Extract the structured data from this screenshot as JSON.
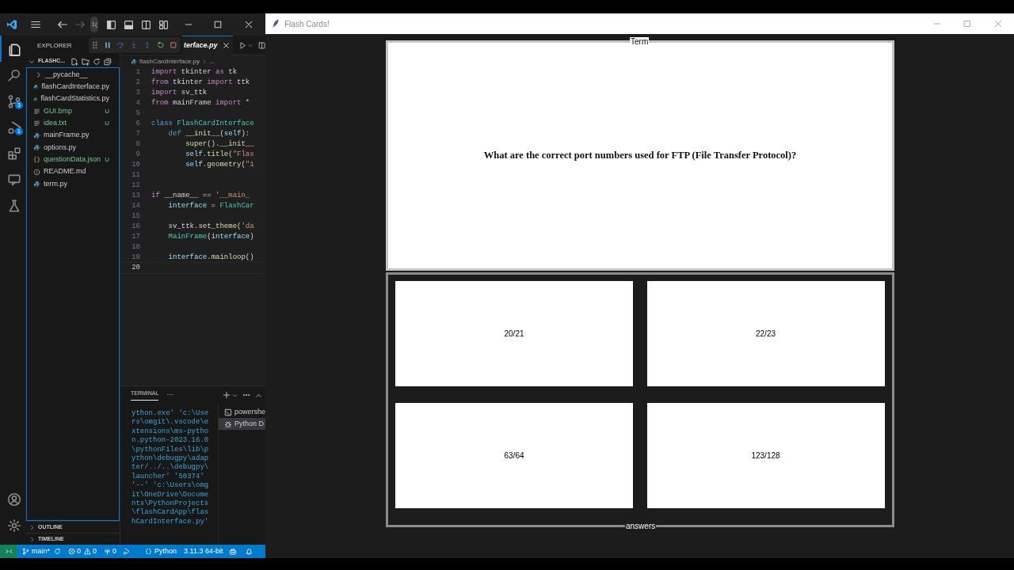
{
  "vscode": {
    "title_bar": {
      "command_center": "1("
    },
    "activity_bar": [
      {
        "kind": "files",
        "selected": true
      },
      {
        "kind": "search",
        "selected": false
      },
      {
        "kind": "source-control",
        "selected": false,
        "badge": "3"
      },
      {
        "kind": "run-debug",
        "selected": false,
        "badge": "1"
      },
      {
        "kind": "extensions",
        "selected": false
      },
      {
        "kind": "remote",
        "selected": false
      },
      {
        "kind": "testing",
        "selected": false
      }
    ],
    "activity_bottom": [
      {
        "kind": "account"
      },
      {
        "kind": "settings"
      }
    ],
    "explorer": {
      "title": "EXPLORER",
      "folder": "FLASHC...",
      "files": [
        {
          "name": "__pycache__",
          "kind": "folder",
          "untracked": false
        },
        {
          "name": "flashCardInterface.py",
          "kind": "python",
          "untracked": false
        },
        {
          "name": "flashCardStatistics.py",
          "kind": "python",
          "untracked": false
        },
        {
          "name": "GUI.bmp",
          "kind": "text",
          "untracked": true,
          "badge": "U"
        },
        {
          "name": "idea.txt",
          "kind": "text",
          "untracked": true,
          "badge": "U"
        },
        {
          "name": "mainFrame.py",
          "kind": "python",
          "untracked": false
        },
        {
          "name": "options.py",
          "kind": "python",
          "untracked": false
        },
        {
          "name": "questionData.json",
          "kind": "json",
          "untracked": true,
          "badge": "U"
        },
        {
          "name": "README.md",
          "kind": "info",
          "untracked": false
        },
        {
          "name": "term.py",
          "kind": "python",
          "untracked": false
        }
      ],
      "sections": [
        "OUTLINE",
        "TIMELINE"
      ]
    },
    "tab": {
      "label": "terface.py"
    },
    "breadcrumb": [
      "flashCardInterface.py",
      "..."
    ],
    "code": [
      {
        "number": "1",
        "current": false,
        "tokens": [
          {
            "text": "import",
            "kind": "keyword"
          },
          {
            "text": " tkinter ",
            "kind": "plain"
          },
          {
            "text": "as",
            "kind": "keyword"
          },
          {
            "text": " tk",
            "kind": "plain"
          }
        ]
      },
      {
        "number": "2",
        "current": false,
        "tokens": [
          {
            "text": "from",
            "kind": "keyword"
          },
          {
            "text": " tkinter ",
            "kind": "plain"
          },
          {
            "text": "import",
            "kind": "keyword"
          },
          {
            "text": " ttk",
            "kind": "plain"
          }
        ]
      },
      {
        "number": "3",
        "current": false,
        "tokens": [
          {
            "text": "import",
            "kind": "keyword"
          },
          {
            "text": " sv_ttk",
            "kind": "plain"
          }
        ]
      },
      {
        "number": "4",
        "current": false,
        "tokens": [
          {
            "text": "from",
            "kind": "keyword"
          },
          {
            "text": " mainFrame ",
            "kind": "plain"
          },
          {
            "text": "import",
            "kind": "keyword"
          },
          {
            "text": " *",
            "kind": "plain"
          }
        ]
      },
      {
        "number": "5",
        "current": false
      },
      {
        "number": "6",
        "current": false,
        "tokens": [
          {
            "text": "class",
            "kind": "storage"
          },
          {
            "text": " FlashCardInterface",
            "kind": "class"
          }
        ]
      },
      {
        "number": "7",
        "current": false,
        "tokens": [
          {
            "text": "    def",
            "kind": "storage"
          },
          {
            "text": " __init__",
            "kind": "function"
          },
          {
            "text": "(",
            "kind": "plain"
          },
          {
            "text": "self",
            "kind": "param"
          },
          {
            "text": "):",
            "kind": "plain"
          }
        ]
      },
      {
        "number": "8",
        "current": false,
        "tokens": [
          {
            "text": "        super",
            "kind": "function"
          },
          {
            "text": "().",
            "kind": "plain"
          },
          {
            "text": "__init__",
            "kind": "function"
          }
        ]
      },
      {
        "number": "9",
        "current": false,
        "tokens": [
          {
            "text": "        self",
            "kind": "param"
          },
          {
            "text": ".",
            "kind": "plain"
          },
          {
            "text": "title",
            "kind": "function"
          },
          {
            "text": "(",
            "kind": "plain"
          },
          {
            "text": "\"Flas",
            "kind": "string"
          }
        ]
      },
      {
        "number": "10",
        "current": false,
        "tokens": [
          {
            "text": "        self",
            "kind": "param"
          },
          {
            "text": ".",
            "kind": "plain"
          },
          {
            "text": "geometry",
            "kind": "function"
          },
          {
            "text": "(",
            "kind": "plain"
          },
          {
            "text": "\"1",
            "kind": "string"
          }
        ]
      },
      {
        "number": "11",
        "current": false
      },
      {
        "number": "12",
        "current": false
      },
      {
        "number": "13",
        "current": false,
        "tokens": [
          {
            "text": "if",
            "kind": "keyword"
          },
          {
            "text": " __name__ == ",
            "kind": "plain"
          },
          {
            "text": "'__main_",
            "kind": "string"
          }
        ]
      },
      {
        "number": "14",
        "current": false,
        "tokens": [
          {
            "text": "    interface",
            "kind": "variable"
          },
          {
            "text": " = ",
            "kind": "plain"
          },
          {
            "text": "FlashCar",
            "kind": "class"
          }
        ]
      },
      {
        "number": "15",
        "current": false
      },
      {
        "number": "16",
        "current": false,
        "tokens": [
          {
            "text": "    sv_ttk",
            "kind": "plain"
          },
          {
            "text": ".",
            "kind": "plain"
          },
          {
            "text": "set_theme",
            "kind": "function"
          },
          {
            "text": "(",
            "kind": "plain"
          },
          {
            "text": "'da",
            "kind": "string"
          }
        ]
      },
      {
        "number": "17",
        "current": false,
        "tokens": [
          {
            "text": "    MainFrame",
            "kind": "class"
          },
          {
            "text": "(",
            "kind": "plain"
          },
          {
            "text": "interface",
            "kind": "variable"
          },
          {
            "text": ")",
            "kind": "plain"
          }
        ]
      },
      {
        "number": "18",
        "current": false
      },
      {
        "number": "19",
        "current": false,
        "tokens": [
          {
            "text": "    interface",
            "kind": "variable"
          },
          {
            "text": ".",
            "kind": "plain"
          },
          {
            "text": "mainloop",
            "kind": "function"
          },
          {
            "text": "()",
            "kind": "plain"
          }
        ]
      },
      {
        "number": "20",
        "current": true
      }
    ],
    "panel": {
      "tab": "TERMINAL",
      "more": "···",
      "lines": [
        "ython.exe' 'c:\\Use",
        "rs\\omgit\\.vscode\\e",
        "xtensions\\ms-pytho",
        "n.python-2023.16.0",
        "\\pythonFiles\\lib\\p",
        "ython\\debugpy\\adap",
        "ter/../..\\debugpy\\",
        "launcher' '50374'",
        "'--' 'c:\\Users\\omg",
        "it\\OneDrive\\Docume",
        "nts\\PythonProjects",
        "\\flashCardApp\\flas",
        "hCardInterface.py'"
      ],
      "terminals": [
        {
          "label": "powershe",
          "kind": "shell",
          "selected": false
        },
        {
          "label": "Python D",
          "kind": "debug",
          "selected": true
        }
      ]
    },
    "status_bar": [
      {
        "kind": "remote"
      },
      {
        "kind": "branch",
        "text": "main*"
      },
      {
        "kind": "sync"
      },
      {
        "kind": "problems",
        "errors": "0",
        "warnings": "0"
      },
      {
        "kind": "ports",
        "text": "0"
      },
      {
        "kind": "debug"
      },
      {
        "kind": "language",
        "text": "Python"
      },
      {
        "kind": "plain",
        "text": "3.11.3 64-bit"
      },
      {
        "kind": "copilot"
      },
      {
        "kind": "bell"
      }
    ]
  },
  "flash_cards": {
    "title": "Flash Cards!",
    "term_label": "Term",
    "question": "What are the correct port numbers used for FTP (File Transfer Protocol)?",
    "answers_label": "answers",
    "answers": [
      "20/21",
      "22/23",
      "63/64",
      "123/128"
    ]
  }
}
